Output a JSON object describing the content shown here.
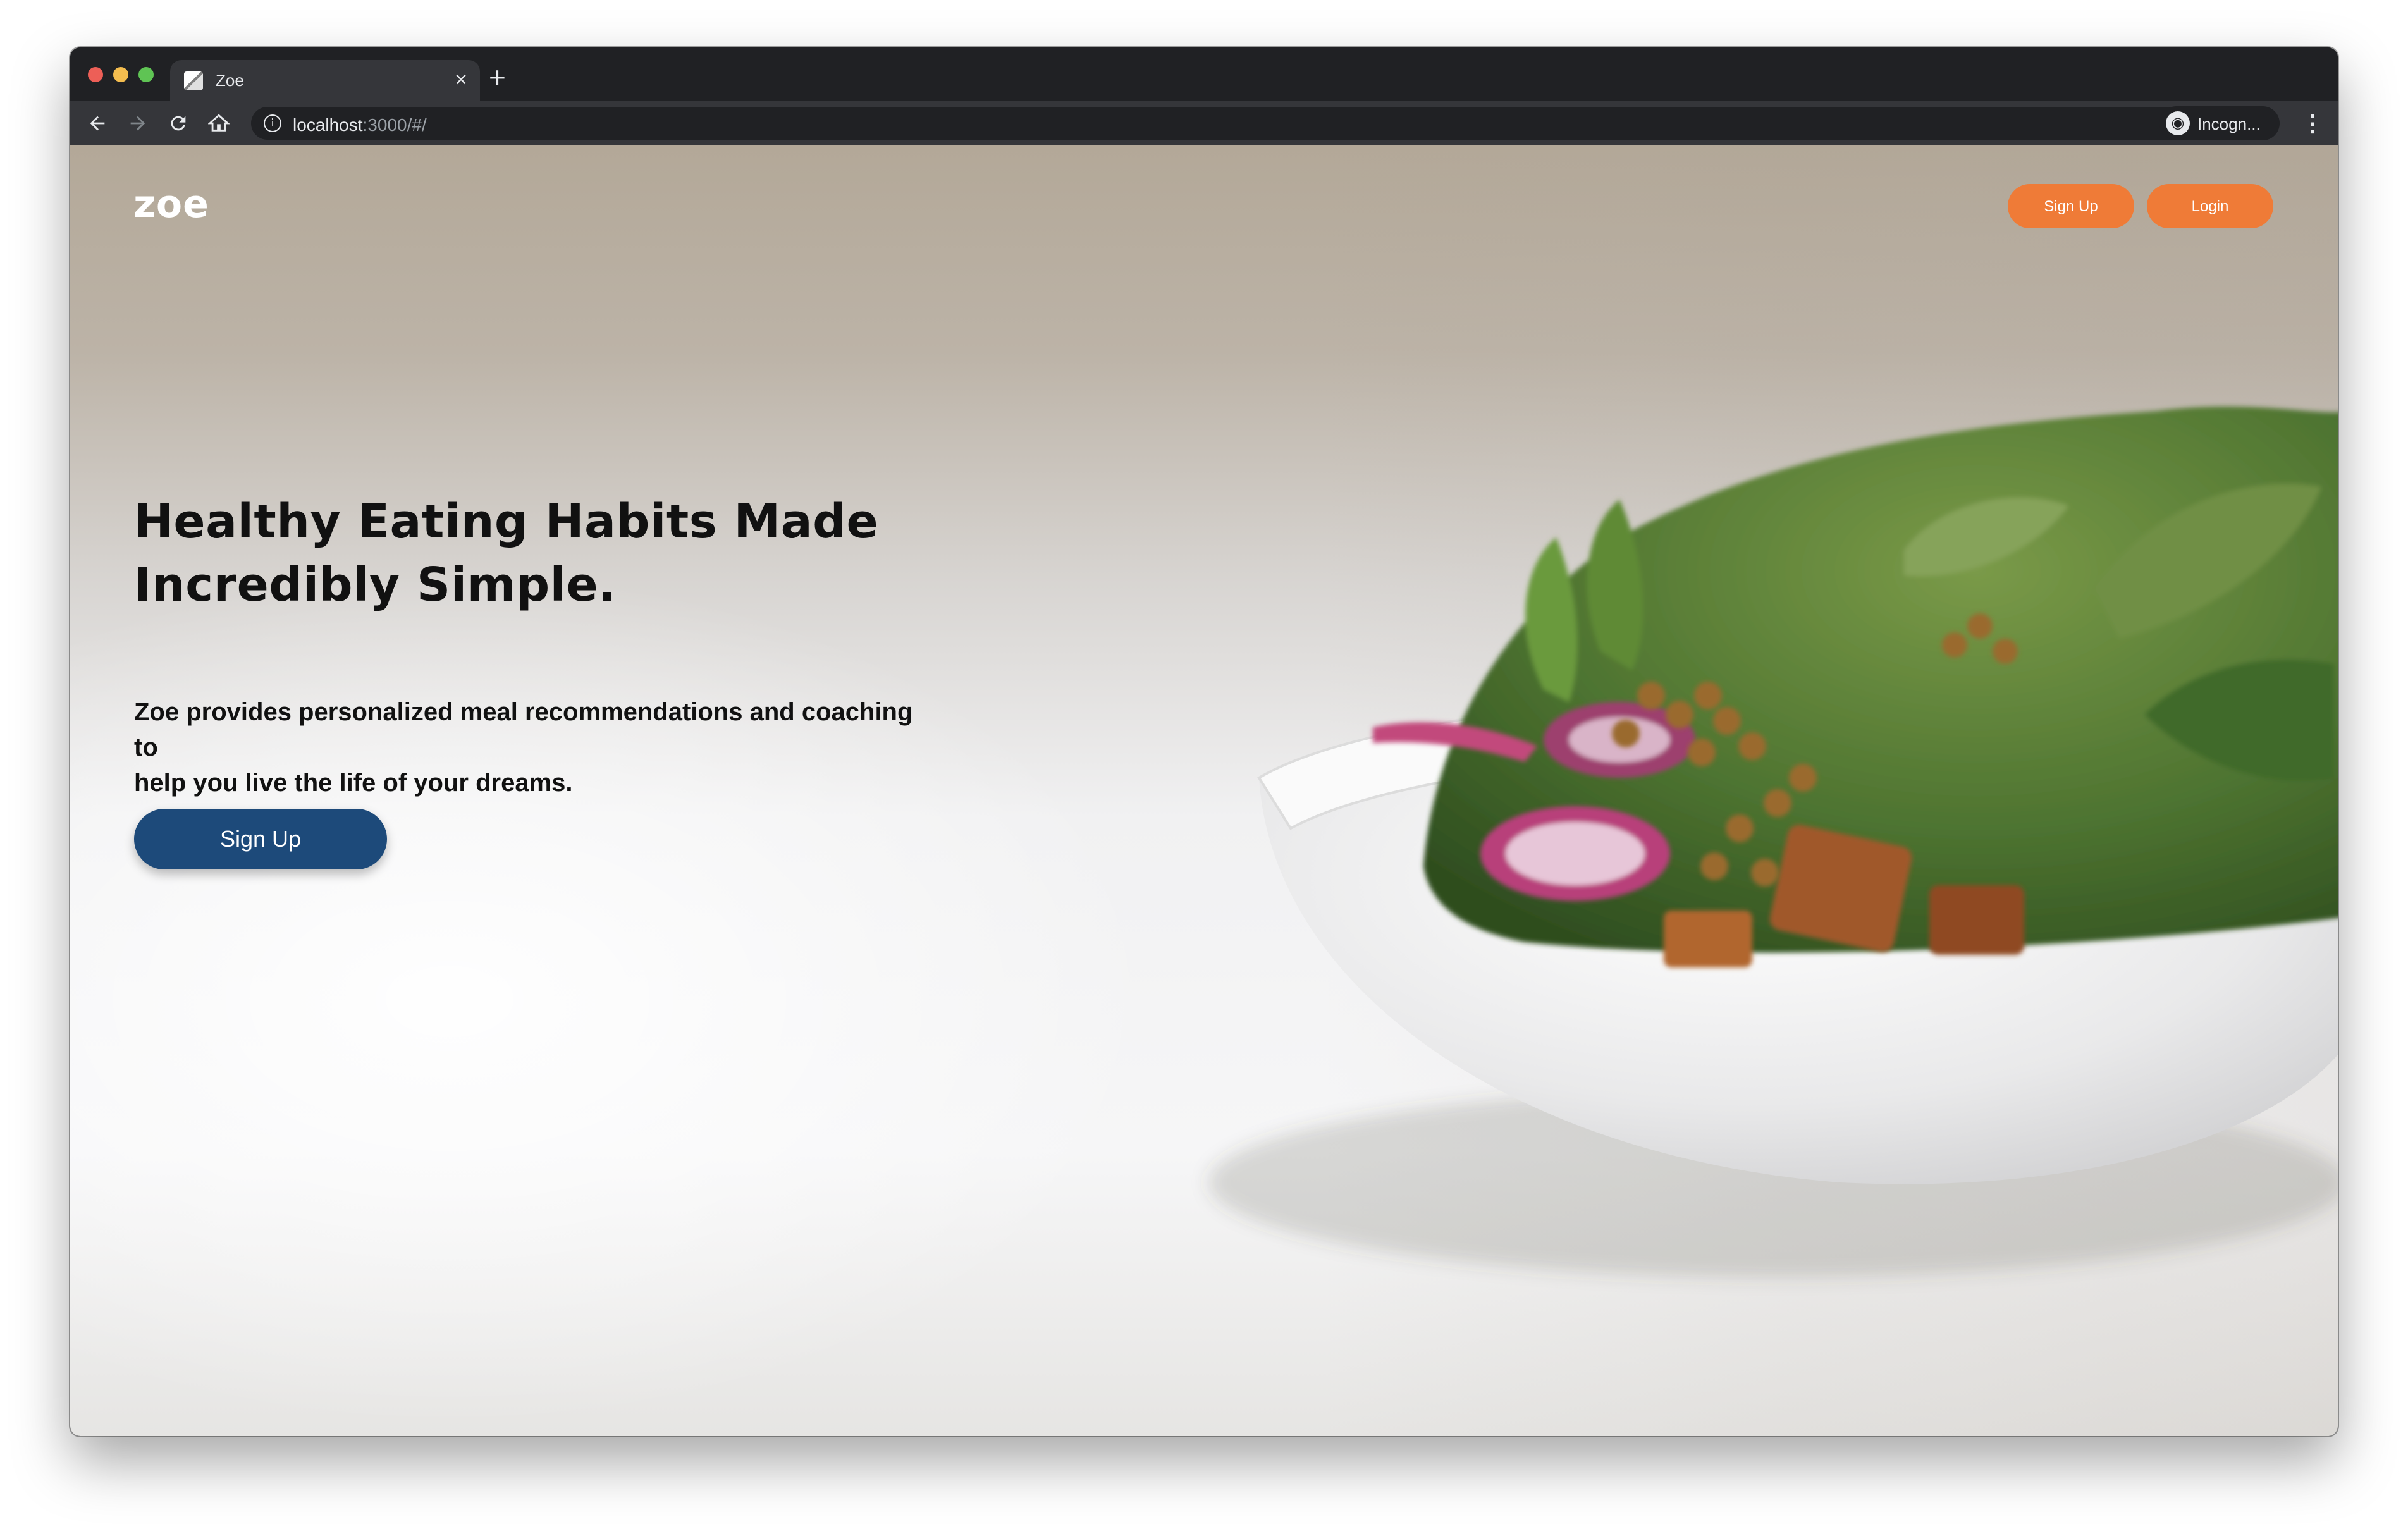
{
  "browser": {
    "tab_title": "Zoe",
    "tab_close": "×",
    "new_tab": "+",
    "url_host": "localhost",
    "url_path": ":3000/#/",
    "profile_label": "Incogn...",
    "icons": {
      "back": "back-arrow-icon",
      "forward": "forward-arrow-icon",
      "reload": "reload-icon",
      "home": "home-icon",
      "info": "info-icon",
      "bookmark": "star-icon",
      "profile": "incognito-icon",
      "menu": "kebab-menu-icon"
    }
  },
  "site": {
    "logo": "zoe",
    "nav": {
      "signup_label": "Sign Up",
      "login_label": "Login"
    },
    "hero": {
      "title_line1": "Healthy Eating Habits Made",
      "title_line2": "Incredibly Simple.",
      "subtitle_line1": "Zoe provides personalized meal recommendations and coaching to",
      "subtitle_line2": "help you live the life of your dreams.",
      "cta_label": "Sign Up"
    }
  },
  "colors": {
    "accent_orange": "#ef7b37",
    "cta_blue": "#1d4a7a",
    "chrome_dark": "#202124",
    "chrome_toolbar": "#35363a"
  }
}
